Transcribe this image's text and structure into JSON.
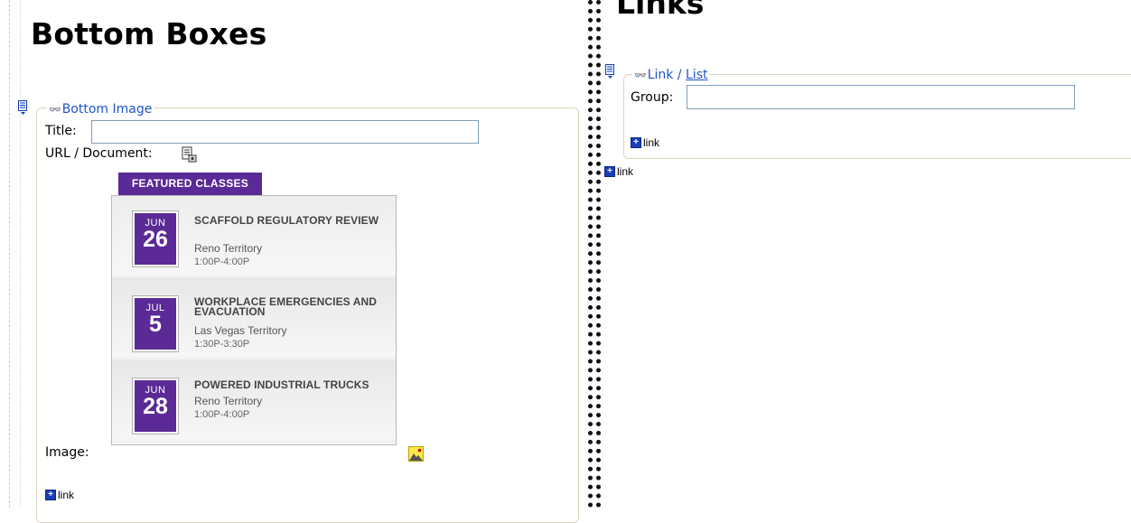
{
  "left": {
    "section_title": "Bottom Boxes",
    "box": {
      "legend_label": "Bottom Image",
      "title_label": "Title:",
      "title_value": "",
      "url_label": "URL / Document:",
      "image_label": "Image:",
      "add_link_label": "link"
    },
    "featured": {
      "tab_label": "FEATURED CLASSES",
      "events": [
        {
          "month": "JUN",
          "day": "26",
          "title": "SCAFFOLD REGULATORY REVIEW",
          "location": "Reno Territory",
          "time": "1:00P-4:00P"
        },
        {
          "month": "JUL",
          "day": "5",
          "title": "WORKPLACE EMERGENCIES AND EVACUATION",
          "location": "Las Vegas Territory",
          "time": "1:30P-3:30P"
        },
        {
          "month": "JUN",
          "day": "28",
          "title": "POWERED INDUSTRIAL TRUCKS",
          "location": "Reno Territory",
          "time": "1:00P-4:00P"
        }
      ]
    }
  },
  "right": {
    "section_title": "Links",
    "box": {
      "legend_link": "Link",
      "legend_separator": " / ",
      "legend_list": "List",
      "group_label": "Group:",
      "group_value": "",
      "add_link_label": "link"
    },
    "outer_add_link_label": "link"
  },
  "colors": {
    "accent_purple": "#5b2a96",
    "legend_blue": "#1f55c8",
    "add_icon_blue": "#1a3eb8"
  }
}
